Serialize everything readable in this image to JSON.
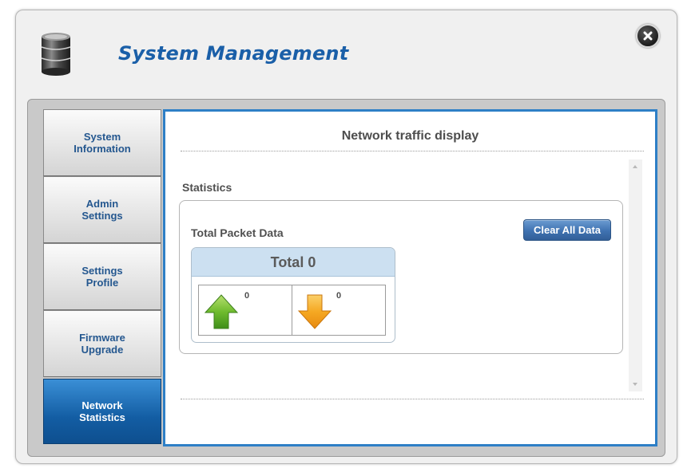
{
  "dialog": {
    "title": "System Management",
    "icons": {
      "app": "database-icon",
      "close": "close-icon"
    }
  },
  "sidebar": {
    "items": [
      {
        "label": "System\nInformation",
        "active": false
      },
      {
        "label": "Admin\nSettings",
        "active": false
      },
      {
        "label": "Settings\nProfile",
        "active": false
      },
      {
        "label": "Firmware\nUpgrade",
        "active": false
      },
      {
        "label": "Network\nStatistics",
        "active": true
      }
    ]
  },
  "panel": {
    "title": "Network traffic display",
    "section_label": "Statistics",
    "box": {
      "title": "Total Packet Data",
      "clear_button": "Clear All Data",
      "total_label": "Total 0",
      "sent_value": "0",
      "received_value": "0",
      "icons": {
        "sent": "upload-arrow-icon",
        "received": "download-arrow-icon"
      }
    }
  },
  "colors": {
    "accent": "#1a5fa8",
    "panel_border": "#2e7fc6",
    "active_tab": "#135da3",
    "upload": "#5fae2e",
    "download": "#f3a21f"
  }
}
